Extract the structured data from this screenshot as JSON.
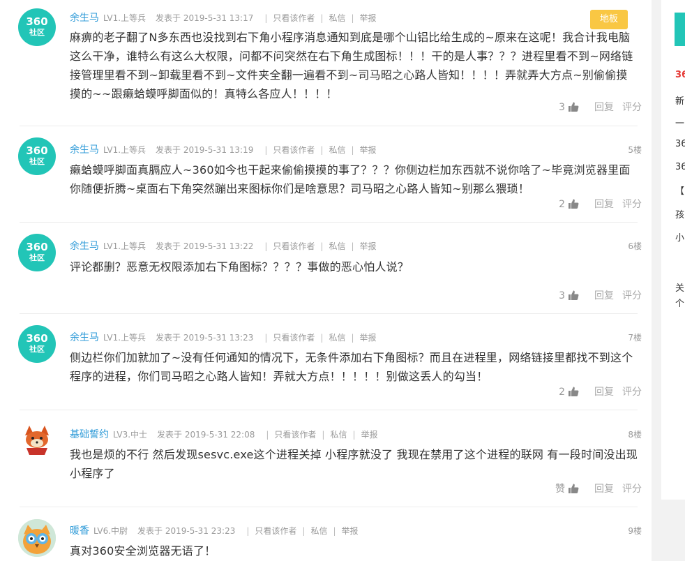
{
  "posts": [
    {
      "avatar": {
        "type": "360",
        "line1": "360",
        "line2": "社区"
      },
      "username": "余生马",
      "level": "LV1.上等兵",
      "posted": "发表于 2019-5-31 13:17",
      "only_author": "只看该作者",
      "message": "私信",
      "report": "举报",
      "floor": "地板",
      "lines": [
        "麻痹的老子翻了N多东西也没找到右下角小程序消息通知到底是哪个山铝比给生成的~原来在这呢！我合计我电脑",
        "这么干净，谁特么有这么大权限，问都不问突然在右下角生成图标！！！干的是人事？？？进程里看不到~网络链",
        "接管理里看不到~卸载里看不到~文件夹全翻一遍看不到~司马昭之心路人皆知！！！！弄就弄大方点~别偷偷摸",
        "摸的~~跟癞蛤蟆呼脚面似的！真特么各应人！！！！"
      ],
      "likes": "3",
      "reply": "回复",
      "rate": "评分"
    },
    {
      "avatar": {
        "type": "360",
        "line1": "360",
        "line2": "社区"
      },
      "username": "余生马",
      "level": "LV1.上等兵",
      "posted": "发表于 2019-5-31 13:19",
      "only_author": "只看该作者",
      "message": "私信",
      "report": "举报",
      "floor": "5楼",
      "lines": [
        "癞蛤蟆呼脚面真膈应人~360如今也干起来偷偷摸摸的事了？？？你侧边栏加东西就不说你啥了~毕竟浏览器里面",
        "你随便折腾~桌面右下角突然蹦出来图标你们是啥意思？司马昭之心路人皆知~别那么猥琐！"
      ],
      "likes": "2",
      "reply": "回复",
      "rate": "评分"
    },
    {
      "avatar": {
        "type": "360",
        "line1": "360",
        "line2": "社区"
      },
      "username": "余生马",
      "level": "LV1.上等兵",
      "posted": "发表于 2019-5-31 13:22",
      "only_author": "只看该作者",
      "message": "私信",
      "report": "举报",
      "floor": "6楼",
      "lines": [
        "评论都删？恶意无权限添加右下角图标？？？？事做的恶心怕人说？"
      ],
      "likes": "3",
      "reply": "回复",
      "rate": "评分"
    },
    {
      "avatar": {
        "type": "360",
        "line1": "360",
        "line2": "社区"
      },
      "username": "余生马",
      "level": "LV1.上等兵",
      "posted": "发表于 2019-5-31 13:23",
      "only_author": "只看该作者",
      "message": "私信",
      "report": "举报",
      "floor": "7楼",
      "lines": [
        "侧边栏你们加就加了~没有任何通知的情况下，无条件添加右下角图标？而且在进程里，网络链接里都找不到这个",
        "程序的进程，你们司马昭之心路人皆知！弄就大方点！！！！！别做这丢人的勾当！"
      ],
      "likes": "2",
      "reply": "回复",
      "rate": "评分"
    },
    {
      "avatar": {
        "type": "fox"
      },
      "username": "基础誓约",
      "level": "LV3.中士",
      "posted": "发表于 2019-5-31 22:08",
      "only_author": "只看该作者",
      "message": "私信",
      "report": "举报",
      "floor": "8楼",
      "lines": [
        "我也是烦的不行 然后发现sesvc.exe这个进程关掉 小程序就没了 我现在禁用了这个进程的联网 有一段时间没出现",
        "小程序了"
      ],
      "likes": "赞",
      "reply": "回复",
      "rate": "评分"
    },
    {
      "avatar": {
        "type": "owl"
      },
      "username": "暖香",
      "level": "LV6.中尉",
      "posted": "发表于 2019-5-31 23:23",
      "only_author": "只看该作者",
      "message": "私信",
      "report": "举报",
      "floor": "9楼",
      "lines": [
        "真对360安全浏览器无语了！"
      ],
      "likes": "",
      "reply": "",
      "rate": ""
    }
  ],
  "sidebar": {
    "items": [
      "36",
      "新",
      "一",
      "36",
      "36",
      "【",
      "孩",
      "小",
      "关",
      "个"
    ]
  },
  "colors": {
    "teal": "#22c5b7",
    "badge": "#f9c743",
    "link": "#2f9bd8"
  }
}
